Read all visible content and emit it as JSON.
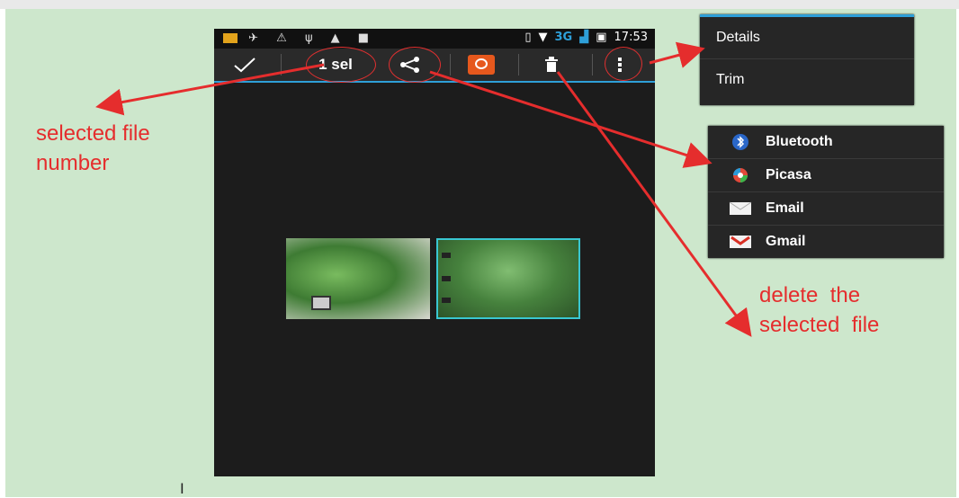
{
  "status_bar": {
    "network": "3G",
    "time": "17:53"
  },
  "action_bar": {
    "selected_count_label": "1 sel"
  },
  "details_menu": {
    "items": [
      "Details",
      "Trim"
    ]
  },
  "share_menu": {
    "items": [
      "Bluetooth",
      "Picasa",
      "Email",
      "Gmail"
    ]
  },
  "annotations": {
    "selected_line1": "selected file",
    "selected_line2": "number",
    "delete_line1": "delete  the",
    "delete_line2": "selected  file"
  },
  "colors": {
    "accent": "#2e9fd8",
    "annotation": "#e52d2d",
    "background": "#cde7cc",
    "slideshow": "#e6581d"
  },
  "icons": [
    "check-icon",
    "share-icon",
    "slideshow-icon",
    "trash-icon",
    "overflow-menu-icon",
    "bluetooth-icon",
    "picasa-icon",
    "email-icon",
    "gmail-icon"
  ]
}
